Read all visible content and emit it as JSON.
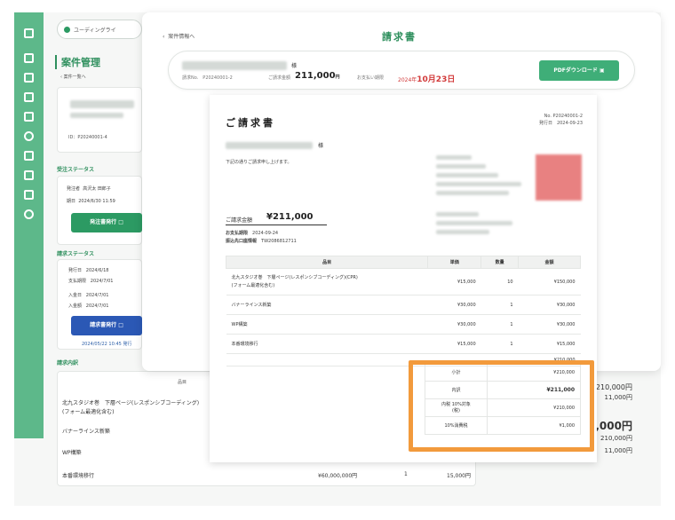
{
  "app": {
    "top_pill": "ユーディングライ",
    "page_title": "案件管理",
    "back_label": "案件一覧へ",
    "sidebar_icons": [
      "home-icon",
      "document-icon",
      "folder-icon",
      "clipboard-icon",
      "chart-icon",
      "clock-icon",
      "users-icon",
      "building-icon",
      "mail-icon",
      "gear-icon"
    ],
    "project_id": "ID：P20240001-4",
    "sections": {
      "receive_status": "受注ステータス",
      "invoice_status": "請求ステータス",
      "invoice_details": "請求内訳"
    },
    "receive_rows": [
      {
        "key": "発注者",
        "value": "高沢太 田郎子"
      },
      {
        "key": "期日",
        "value": "2024/6/30 11:59"
      }
    ],
    "receive_button": "発注書発行",
    "invoice_rows": [
      {
        "key": "発行日",
        "value": "2024/6/18"
      },
      {
        "key": "支払期限",
        "value": "2024/7/01"
      },
      {
        "key": "入金日",
        "value": "2024/7/01"
      },
      {
        "key": "入金額",
        "value": "2024/7/01"
      }
    ],
    "invoice_button": "請求書発行",
    "invoice_issued_link": "2024/05/22 10:45 発行",
    "bg_table": {
      "header": "品目",
      "rows": [
        {
          "item": "北九スタジオ巻　下層ページ(レスポンシブコーディング)",
          "item2": "(フォーム最適化含む)",
          "value": "210,000円"
        },
        {
          "item": "バナーラインス新築",
          "value": "11,000円"
        },
        {
          "item": "WP構築",
          "value": ""
        },
        {
          "item": "本番環境移行",
          "unit": "¥60,000,000円",
          "qty": "1",
          "value": "15,000円"
        }
      ],
      "right_totals": [
        "210,000円",
        "11,000円",
        "211,000円",
        "210,000円",
        "11,000円"
      ]
    }
  },
  "modal": {
    "back_label": "案件情報へ",
    "title": "請求書",
    "summary": {
      "company": "株式会社フェリングデザイン",
      "company_suffix": "様",
      "invoice_no": "請求No.　P20240001-2",
      "amount_label": "ご請求金額",
      "amount": "211,000",
      "amount_unit": "円",
      "due_label": "お支払い期限",
      "due_year": "2024年",
      "due_date": "10月23日",
      "pdf_button": "PDFダウンロード"
    }
  },
  "invoice": {
    "title": "ご請求書",
    "doc_no": "No. P20240001-2",
    "issue_date": "発行日　2024-09-23",
    "client": "株式会社フェリングデザイン",
    "client_suffix": "様",
    "greeting": "下記の通りご請求申し上げます。",
    "bill_label": "ご請求金額",
    "bill_amount": "¥211,000",
    "due_label": "お支払期限",
    "due_value": "2024-09-24",
    "account_label": "振込先口座情報",
    "account_value": "TW2086812711",
    "table": {
      "headers": [
        "品目",
        "単価",
        "数量",
        "金額"
      ],
      "rows": [
        {
          "item": "北九スタジオ巻　下層ページ(レスポンシブコーディング)(CPR)",
          "item2": "(フォーム最適化含む)",
          "unit": "¥15,000",
          "qty": "10",
          "amount": "¥150,000"
        },
        {
          "item": "バナーラインス新築",
          "unit": "¥30,000",
          "qty": "1",
          "amount": "¥30,000"
        },
        {
          "item": "WP構築",
          "unit": "¥30,000",
          "qty": "1",
          "amount": "¥30,000"
        },
        {
          "item": "本番環境移行",
          "unit": "¥15,000",
          "qty": "1",
          "amount": "¥15,000"
        }
      ],
      "subtotal_row": "¥210,000"
    },
    "totals": [
      {
        "label": "小計",
        "value": "¥210,000"
      },
      {
        "label": "内訳",
        "value": "¥211,000"
      },
      {
        "label": "内税 10%対象",
        "label2": "(税)",
        "value": "¥210,000"
      },
      {
        "label": "10%消費税",
        "value": "¥1,000"
      }
    ]
  },
  "colors": {
    "accent_green": "#3fae78",
    "sidebar_green": "#5db88a",
    "highlight_orange": "#f29a3c",
    "due_red": "#d23a3a",
    "stamp_red": "#e56c6c"
  }
}
